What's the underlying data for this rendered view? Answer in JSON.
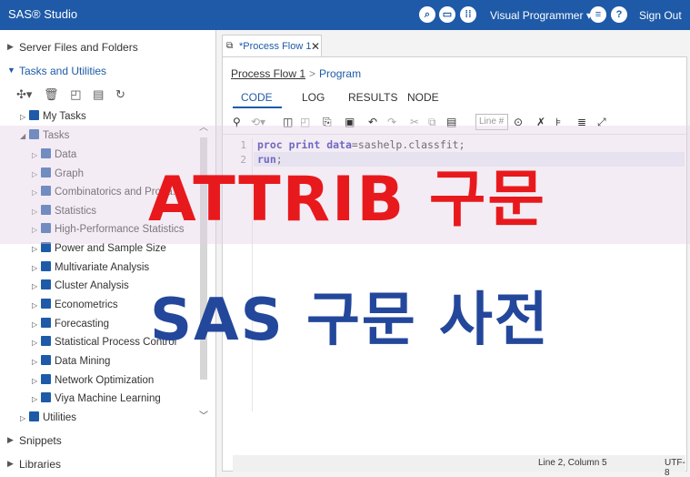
{
  "topbar": {
    "app_title": "SAS® Studio",
    "icons": [
      "search-icon",
      "folder-icon",
      "apps-icon",
      "menu-icon",
      "help-icon"
    ],
    "perspective": "Visual Programmer",
    "perspective_arrow": "▾",
    "sign_out": "Sign Out",
    "help_glyph": "?"
  },
  "left": {
    "sections": {
      "server": "Server Files and Folders",
      "tasks": "Tasks and Utilities",
      "snippets": "Snippets",
      "libraries": "Libraries"
    },
    "tree": {
      "my_tasks": "My Tasks",
      "tasks": "Tasks",
      "children": [
        "Data",
        "Graph",
        "Combinatorics and Proba...",
        "Statistics",
        "High-Performance Statistics",
        "Power and Sample Size",
        "Multivariate Analysis",
        "Cluster Analysis",
        "Econometrics",
        "Forecasting",
        "Statistical Process Control",
        "Data Mining",
        "Network Optimization",
        "Viya Machine Learning"
      ],
      "utilities": "Utilities"
    }
  },
  "right": {
    "tab_label": "*Process Flow 1",
    "tab_close": "✕",
    "breadcrumb": {
      "flow": "Process Flow 1",
      "sep": ">",
      "current": "Program"
    },
    "subtabs": [
      "CODE",
      "LOG",
      "RESULTS",
      "NODE"
    ],
    "line_placeholder": "Line #",
    "code_lines": [
      {
        "num": "1",
        "kw1": "proc",
        "kw2": "print",
        "kw3": "data",
        "rest": "=sashelp.classfit;"
      },
      {
        "num": "2",
        "kw1": "run",
        "rest": ";"
      }
    ],
    "status": {
      "position": "Line 2, Column 5",
      "encoding": "UTF-8"
    }
  },
  "overlay": {
    "title": "ATTRIB 구문",
    "subtitle": "SAS 구문 사전"
  }
}
